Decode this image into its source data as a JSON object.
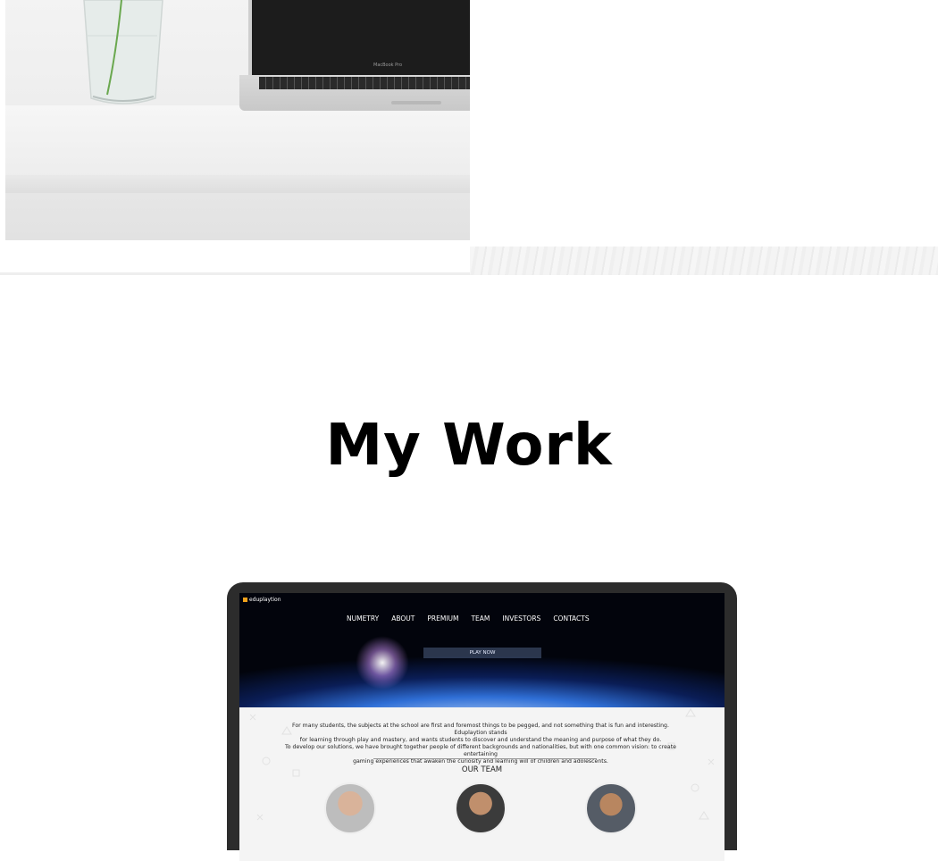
{
  "hero": {
    "laptop_brand": "MacBook Pro"
  },
  "section": {
    "title": "My Work"
  },
  "portfolio_item": {
    "site": {
      "logo_text": "eduplaytion",
      "nav": [
        "NUMETRY",
        "ABOUT",
        "PREMIUM",
        "TEAM",
        "INVESTORS",
        "CONTACTS"
      ],
      "cta_label": "PLAY NOW",
      "intro_lines": [
        "For many students, the subjects at the school are first and foremost things to be pegged, and not something that is fun and interesting. Eduplaytion stands",
        "for learning through play and mastery, and wants students to discover and understand the meaning and purpose of what they do.",
        "To develop our solutions, we have brought together people of different backgrounds and nationalities, but with one common vision: to create entertaining",
        "gaming experiences that awaken the curiosity and learning will of children and adolescents."
      ],
      "team_title": "OUR TEAM"
    }
  },
  "colors": {
    "title": "#000000",
    "device_frame": "#2c2c2c",
    "logo_mark": "#f0a21b"
  }
}
